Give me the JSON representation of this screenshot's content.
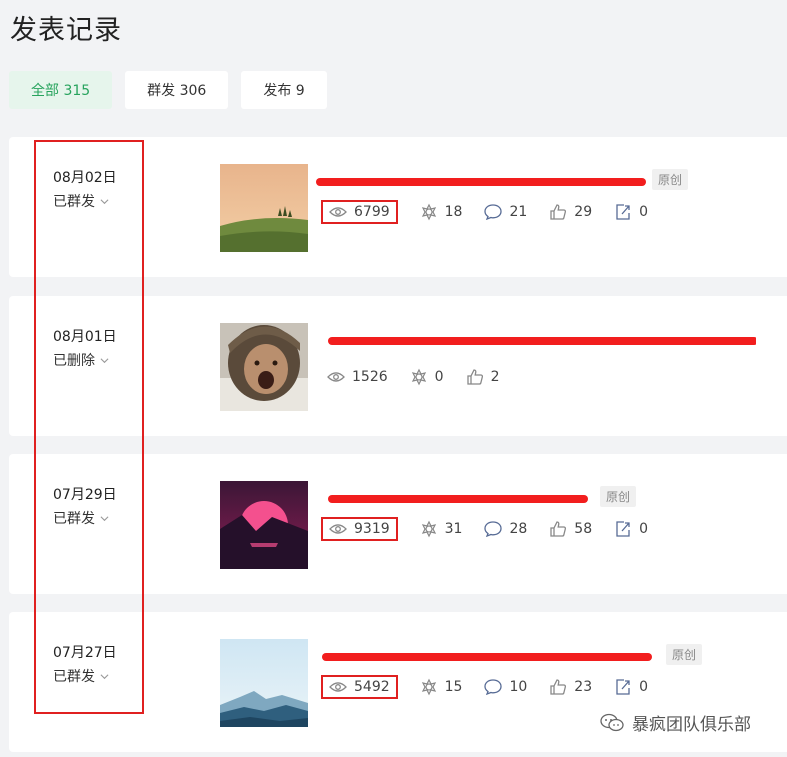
{
  "page": {
    "title": "发表记录"
  },
  "tabs": [
    {
      "label": "全部 315",
      "active": true
    },
    {
      "label": "群发 306",
      "active": false
    },
    {
      "label": "发布 9",
      "active": false
    }
  ],
  "records": [
    {
      "date": "08月02日",
      "status": "已群发",
      "title": "",
      "badge": "原创",
      "views": "6799",
      "shares": "18",
      "comments": "21",
      "likes": "29",
      "forwards": "0"
    },
    {
      "date": "08月01日",
      "status": "已删除",
      "title": "",
      "badge": "",
      "views": "1526",
      "shares": "0",
      "likes": "2"
    },
    {
      "date": "07月29日",
      "status": "已群发",
      "title": "",
      "badge": "原创",
      "views": "9319",
      "shares": "31",
      "comments": "28",
      "likes": "58",
      "forwards": "0"
    },
    {
      "date": "07月27日",
      "status": "已群发",
      "title": "",
      "badge": "原创",
      "views": "5492",
      "shares": "15",
      "comments": "10",
      "likes": "23",
      "forwards": "0"
    }
  ],
  "watermark": {
    "text": "暴疯团队俱乐部"
  },
  "colors": {
    "accent_green": "#27a35d",
    "annotation_red": "#e02020"
  }
}
